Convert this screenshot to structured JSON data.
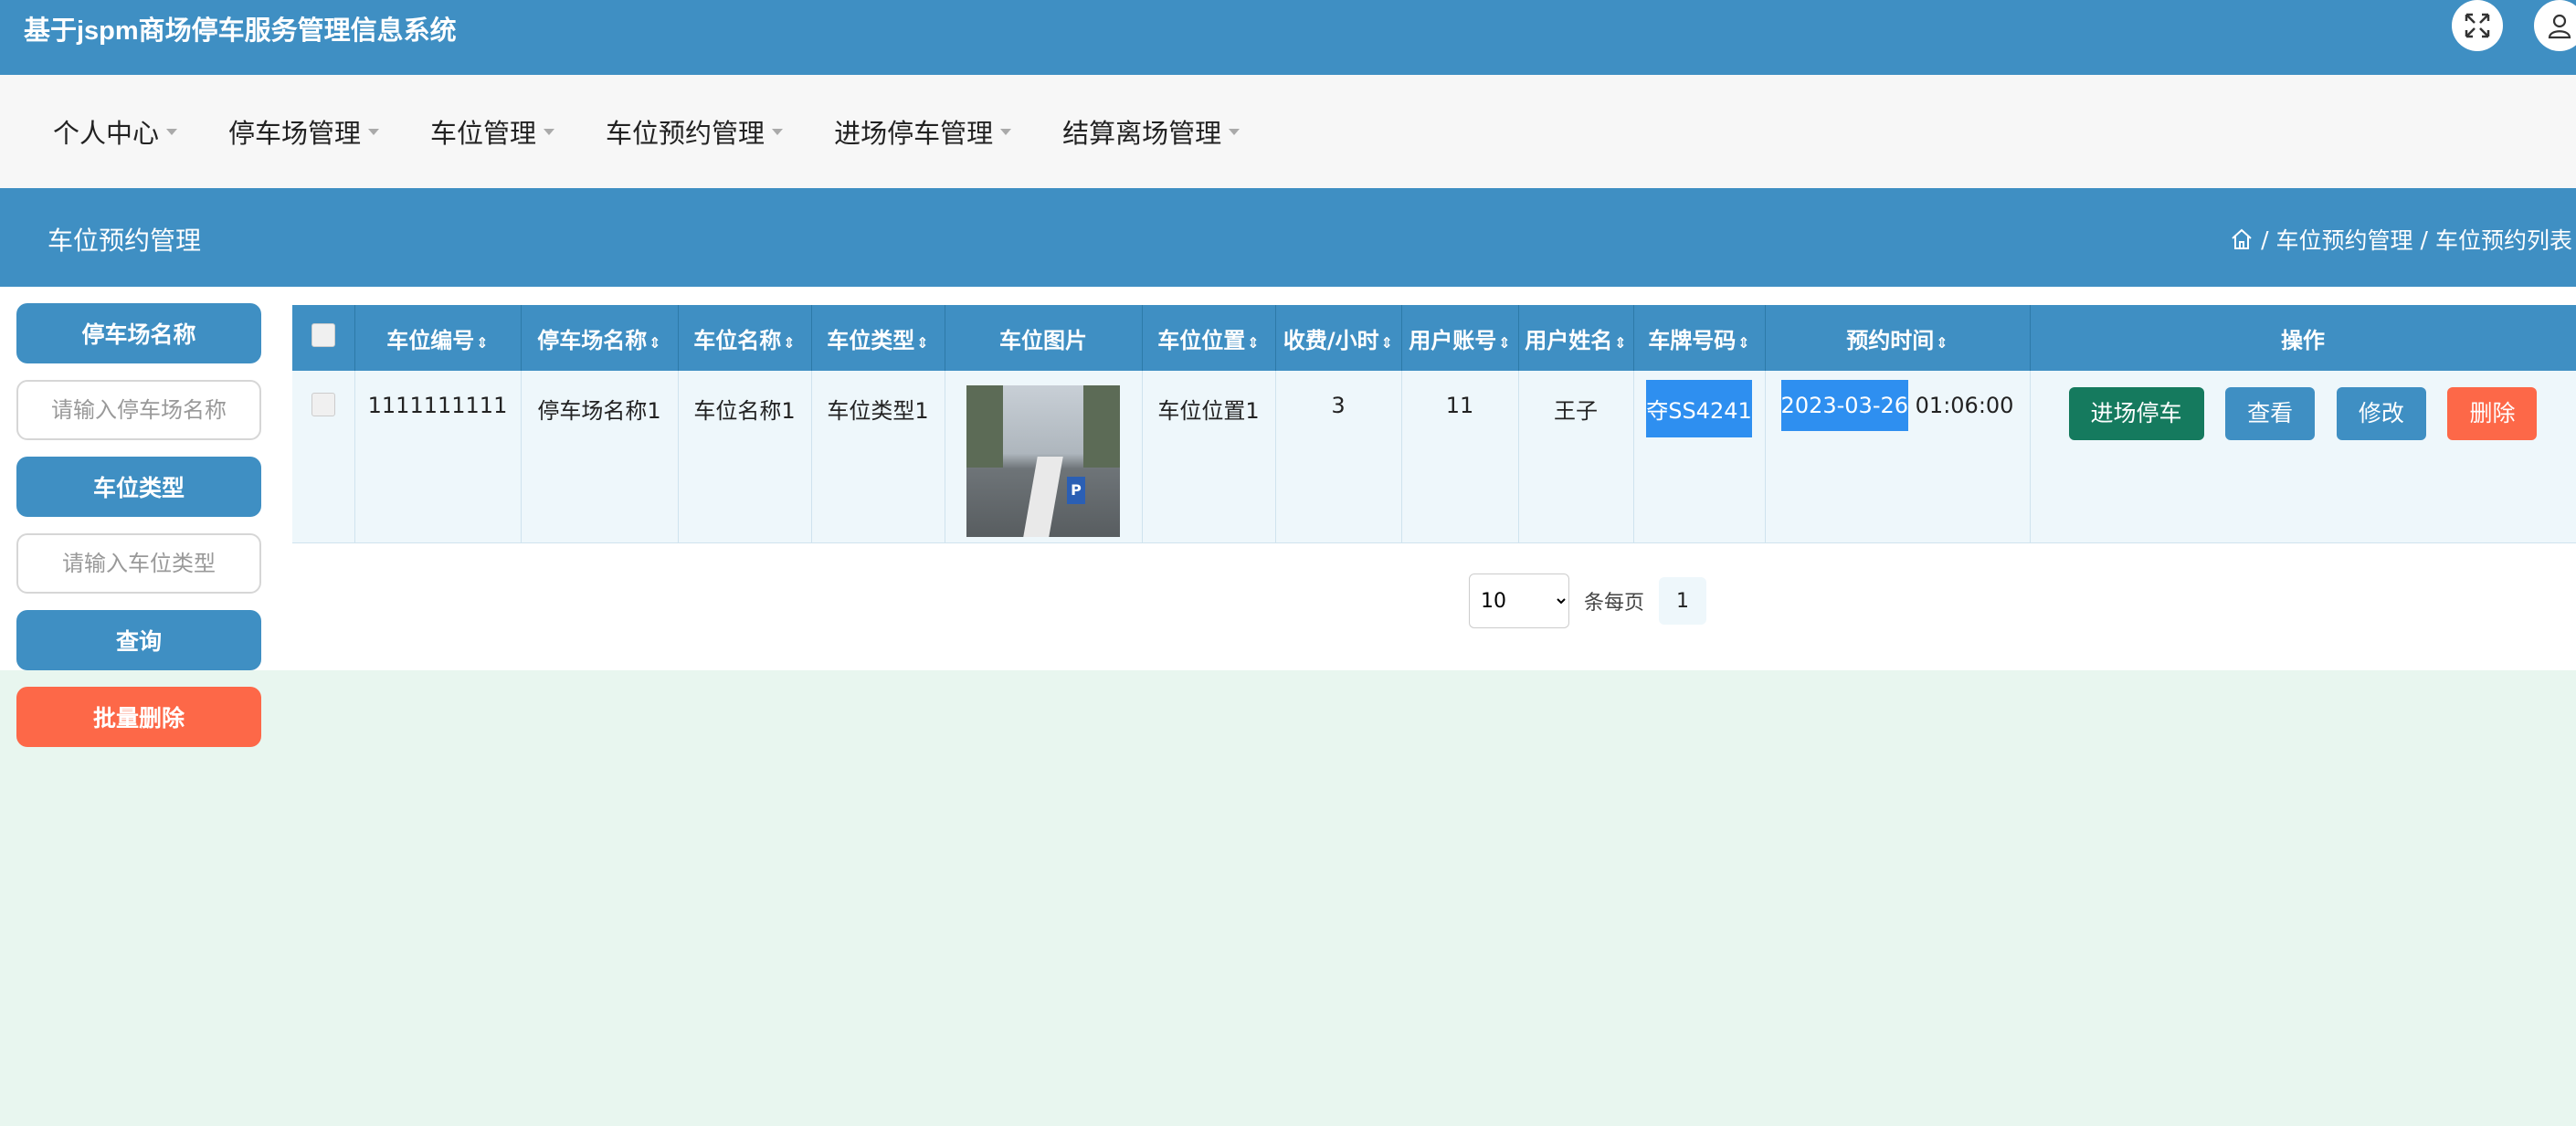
{
  "header": {
    "title": "基于jspm商场停车服务管理信息系统"
  },
  "nav": [
    {
      "label": "个人中心"
    },
    {
      "label": "停车场管理"
    },
    {
      "label": "车位管理"
    },
    {
      "label": "车位预约管理"
    },
    {
      "label": "进场停车管理"
    },
    {
      "label": "结算离场管理"
    }
  ],
  "page": {
    "title": "车位预约管理",
    "breadcrumb": [
      "车位预约管理",
      "车位预约列表"
    ]
  },
  "search": {
    "lot_name_label": "停车场名称",
    "lot_name_placeholder": "请输入停车场名称",
    "space_type_label": "车位类型",
    "space_type_placeholder": "请输入车位类型",
    "query_label": "查询",
    "batch_delete_label": "批量删除"
  },
  "table": {
    "columns": [
      "车位编号",
      "停车场名称",
      "车位名称",
      "车位类型",
      "车位图片",
      "车位位置",
      "收费/小时",
      "用户账号",
      "用户姓名",
      "车牌号码",
      "预约时间",
      "操作"
    ],
    "rows": [
      {
        "space_no": "1111111111",
        "lot_name": "停车场名称1",
        "space_name": "车位名称1",
        "space_type": "车位类型1",
        "location": "车位位置1",
        "fee": "3",
        "account": "11",
        "user_name": "王子",
        "plate_selected": "夺SS4241",
        "time_selected": "2023-03-26",
        "time_rest": " 01:06:00",
        "actions": {
          "enter": "进场停车",
          "view": "查看",
          "edit": "修改",
          "delete": "删除"
        }
      }
    ]
  },
  "pager": {
    "page_size": "10",
    "per_page_label": "条每页",
    "current_page": "1"
  },
  "colors": {
    "primary": "#3f8fc3",
    "enter_button": "#157a5e",
    "danger": "#fd6848",
    "page_background": "#e8f6ef"
  }
}
